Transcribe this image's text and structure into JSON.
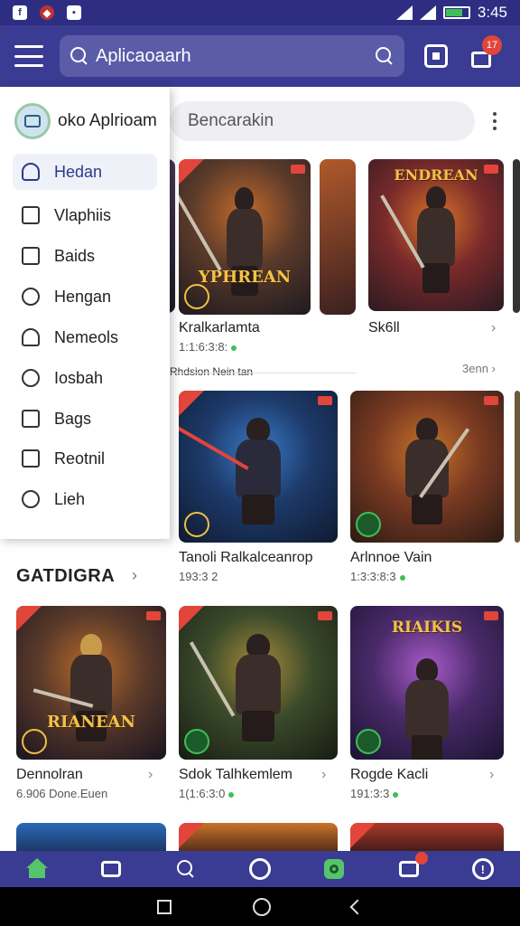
{
  "status_bar": {
    "time": "3:45",
    "icons": [
      "facebook-icon",
      "app-icon",
      "messenger-icon",
      "wifi-icon",
      "signal-icon",
      "battery-icon"
    ]
  },
  "app_bar": {
    "search_placeholder": "Aplicaoaarh",
    "notification_count": "17"
  },
  "drawer": {
    "title": "oko Aplrioam",
    "items": [
      {
        "label": "Hedan",
        "icon": "user-icon",
        "active": true
      },
      {
        "label": "Vlaphiis",
        "icon": "square-icon",
        "active": false
      },
      {
        "label": "Baids",
        "icon": "box-icon",
        "active": false
      },
      {
        "label": "Hengan",
        "icon": "circle-icon",
        "active": false
      },
      {
        "label": "Nemeols",
        "icon": "home-icon",
        "active": false
      },
      {
        "label": "Iosbah",
        "icon": "compass-icon",
        "active": false
      },
      {
        "label": "Bags",
        "icon": "bag-icon",
        "active": false
      },
      {
        "label": "Reotnil",
        "icon": "pause-icon",
        "active": false
      },
      {
        "label": "Lieh",
        "icon": "search-icon",
        "active": false
      }
    ]
  },
  "content": {
    "search_placeholder": "Bencarakin",
    "row1_label": "Rhdsion Nein tan",
    "row1_more": "3enn",
    "section_title": "GATDIGRA",
    "cards": [
      {
        "title": "Kralkarlamta",
        "sub": "1:1:6:3:8:",
        "logo": "YPHREAN",
        "colors": [
          "#5a3a2a",
          "#1e1a20"
        ]
      },
      {
        "title": "Sk6ll",
        "sub": "",
        "logo": "ENDREAN",
        "colors": [
          "#7a2a2a",
          "#2a1a22"
        ]
      },
      {
        "title": "Tanoli Ralkalceanrop",
        "sub": "193:3 2",
        "logo": "",
        "colors": [
          "#1d3a6a",
          "#0f1a30"
        ]
      },
      {
        "title": "Arlnnoe Vain",
        "sub": "1:3:3:8:3",
        "logo": "",
        "colors": [
          "#7a3a22",
          "#2a1a14"
        ]
      },
      {
        "title": "Dennolran",
        "sub": "6.906 Done.Euen",
        "logo": "RIANEAN",
        "colors": [
          "#5a3a2a",
          "#1a1420"
        ]
      },
      {
        "title": "Sdok Talhkemlem",
        "sub": "1(1:6:3:0",
        "logo": "",
        "colors": [
          "#3a4a2a",
          "#181c14"
        ]
      },
      {
        "title": "Rogde Kacli",
        "sub": "191:3:3",
        "logo": "RIAIKIS",
        "colors": [
          "#4a2a6a",
          "#1a1430"
        ]
      }
    ]
  },
  "bottom_nav": {
    "items": [
      "home-icon",
      "chat-icon",
      "search-icon",
      "circle-icon",
      "camera-icon",
      "message-icon",
      "info-icon"
    ]
  },
  "system_nav": [
    "recent-apps-icon",
    "home-button-icon",
    "back-icon"
  ]
}
